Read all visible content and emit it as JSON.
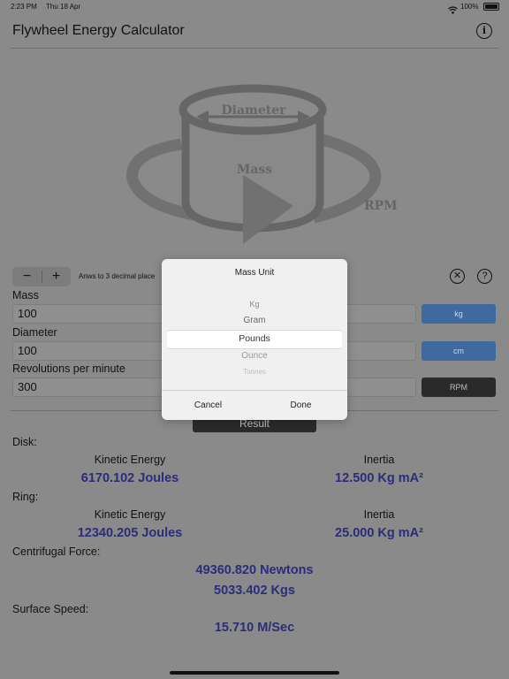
{
  "status_bar": {
    "time": "2:23 PM",
    "date": "Thu 18 Apr",
    "battery": "100%"
  },
  "header": {
    "title": "Flywheel Energy Calculator",
    "info_icon": "info-icon"
  },
  "diagram": {
    "diameter_label": "Diameter",
    "mass_label": "Mass",
    "rpm_label": "RPM"
  },
  "controls": {
    "decrement": "−",
    "increment": "+",
    "decimals_label": "Anws to 3 decimal place",
    "clear_icon": "close-circle-icon",
    "help_icon": "?"
  },
  "inputs": [
    {
      "label": "Mass",
      "value": "100",
      "unit": "kg"
    },
    {
      "label": "Diameter",
      "value": "100",
      "unit": "cm"
    },
    {
      "label": "Revolutions per minute",
      "value": "300",
      "unit": "RPM"
    }
  ],
  "result_button": "Result",
  "results": {
    "disk": {
      "label": "Disk:",
      "ke_label": "Kinetic Energy",
      "ke_value": "6170.102 Joules",
      "inertia_label": "Inertia",
      "inertia_value": "12.500 Kg mA²"
    },
    "ring": {
      "label": "Ring:",
      "ke_label": "Kinetic Energy",
      "ke_value": "12340.205 Joules",
      "inertia_label": "Inertia",
      "inertia_value": "25.000 Kg mA²"
    },
    "centrifugal": {
      "label": "Centrifugal Force:",
      "newtons": "49360.820 Newtons",
      "kgs": "5033.402 Kgs"
    },
    "surface": {
      "label": "Surface Speed:",
      "value": "15.710 M/Sec"
    }
  },
  "modal": {
    "title": "Mass Unit",
    "options": [
      "Kg",
      "Gram",
      "Pounds",
      "Ounce",
      "Tonnes"
    ],
    "selected": "Pounds",
    "cancel": "Cancel",
    "done": "Done"
  }
}
